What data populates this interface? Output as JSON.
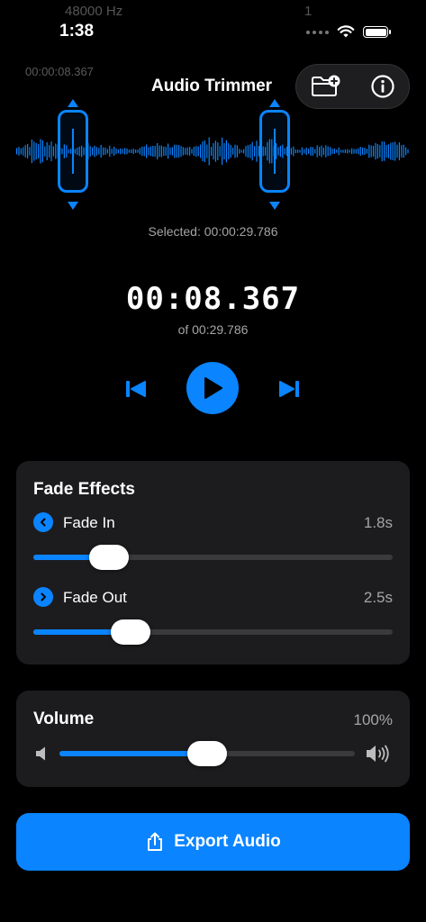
{
  "status": {
    "time": "1:38",
    "ghost_left": "48000 Hz",
    "ghost_right": "1"
  },
  "header": {
    "title": "Audio Trimmer",
    "ghost_timestamp": "00:00:08.367",
    "icons": [
      "folder-plus-icon",
      "info-icon"
    ]
  },
  "trim": {
    "selected_label": "Selected: 00:00:29.786",
    "start_fraction": 0.148,
    "end_fraction": 0.656
  },
  "playback": {
    "current_time": "00:08.367",
    "total_time": "of 00:29.786"
  },
  "fade": {
    "title": "Fade Effects",
    "fade_in": {
      "label": "Fade In",
      "value": "1.8s",
      "fraction": 0.21
    },
    "fade_out": {
      "label": "Fade Out",
      "value": "2.5s",
      "fraction": 0.27
    }
  },
  "volume": {
    "title": "Volume",
    "value": "100%",
    "fraction": 0.5
  },
  "export": {
    "label": "Export Audio"
  },
  "colors": {
    "accent": "#0a84ff",
    "card": "#1c1c1e",
    "background": "#000000"
  }
}
